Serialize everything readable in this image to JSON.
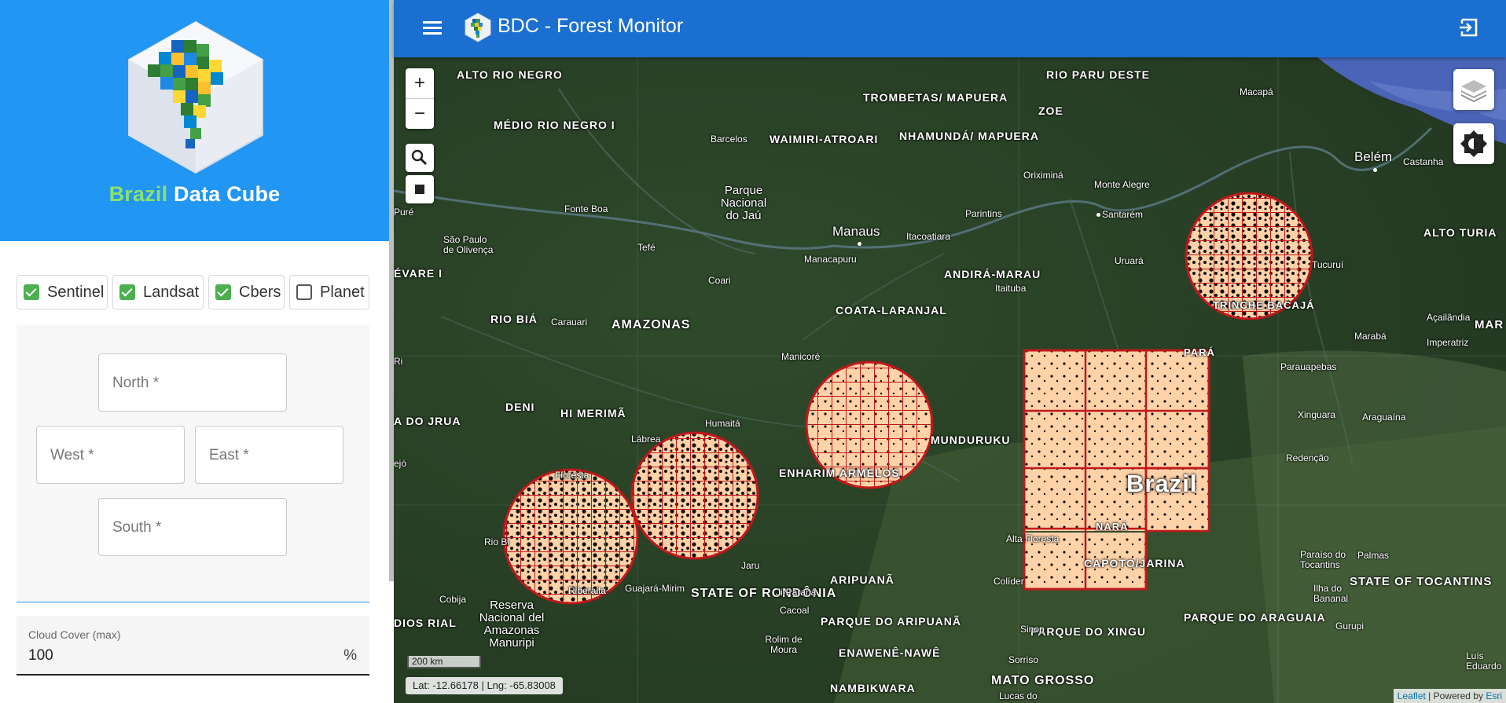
{
  "sidebar": {
    "logo_text_accent": "Brazil",
    "logo_text_rest": " Data Cube",
    "collections": [
      {
        "label": "Sentinel",
        "checked": true
      },
      {
        "label": "Landsat",
        "checked": true
      },
      {
        "label": "Cbers",
        "checked": true
      },
      {
        "label": "Planet",
        "checked": false
      }
    ],
    "bbox": {
      "north_placeholder": "North *",
      "west_placeholder": "West *",
      "east_placeholder": "East *",
      "south_placeholder": "South *"
    },
    "cloud_cover": {
      "label": "Cloud Cover (max)",
      "value": "100",
      "unit": "%"
    }
  },
  "appbar": {
    "title": "BDC - Forest Monitor",
    "color": "#1a6fd0",
    "menu_icon": "hamburger-icon",
    "logout_icon": "logout-icon"
  },
  "map": {
    "region_labels": [
      "ALTO RIO NEGRO",
      "RIO PARU DESTE",
      "TROMBETAS/ MAPUERA",
      "ZOE",
      "MÉDIO RIO NEGRO I",
      "WAIMIRI-ATROARI",
      "NHAMUNDÁ/ MAPUERA",
      "ÉVARE I",
      "RIO BIÁ",
      "AMAZONAS",
      "ANDIRÁ-MARAU",
      "COATA-LARANJAL",
      "DENI",
      "HI MERIMÃ",
      "A DO JRUA",
      "MUNDURUKU",
      "ENHARIM ARMELOS",
      "STATE OF RONDÔNIA",
      "ARIPUANÃ",
      "CAPOTO/JARINA",
      "PARQUE DO ARIPUANÃ",
      "PARQUE DO XINGU",
      "PARQUE DO ARAGUAIA",
      "STATE OF TOCANTINS",
      "ENAWENÊ-NAWÊ",
      "NAMBIKWARA",
      "MATO GROSSO",
      "ALTO TURIA",
      "DIOS RIAL",
      "MAR",
      "TRINCHE BACAJÁ",
      "PARÁ",
      "NARÁ"
    ],
    "city_labels": [
      "Macapá",
      "Belém",
      "Castanha",
      "Barcelos",
      "Oriximiná",
      "Monte Alegre",
      "Santarém",
      "Parintins",
      "Fonte Boa",
      "São Paulo de Olivença",
      "Tefé",
      "Coari",
      "Manaus",
      "Manacapuru",
      "Itacoatiara",
      "Itaituba",
      "Uruará",
      "Tucuruí",
      "Carauari",
      "Manicoré",
      "Humaitá",
      "Lábrea",
      "Marabá",
      "Açailândia",
      "Imperatriz",
      "Parauapebas",
      "Xinguara",
      "Araguaína",
      "Redenção",
      "Floresta",
      "Rio Bi",
      "Ji-Paraná",
      "Jaru",
      "Guajará-Mirim",
      "Riberalta",
      "Cobija",
      "Cacoal",
      "Rolim de Moura",
      "Alta Floresta",
      "Colíder",
      "Sinop",
      "Sorriso",
      "Lucas do",
      "Ilha do Bananal",
      "Paraíso do Tocantins",
      "Palmas",
      "Gurupi",
      "Luís Eduardo",
      "Parque Nacional do Jaú",
      "Reserva Nacional del Amazonas Manuripi",
      "Puré",
      "Ri",
      "ejó"
    ],
    "country_label": "Brazil",
    "zoom_in": "+",
    "zoom_out": "−",
    "scale": "200 km",
    "coords": "Lat: -12.66178 | Lng: -65.83008",
    "attribution_link": "Leaflet",
    "attribution_rest": " | Powered by ",
    "attribution_esri": "Esri",
    "grid_color": "#c0181a",
    "deforestation_color": "#ffd2a8"
  }
}
